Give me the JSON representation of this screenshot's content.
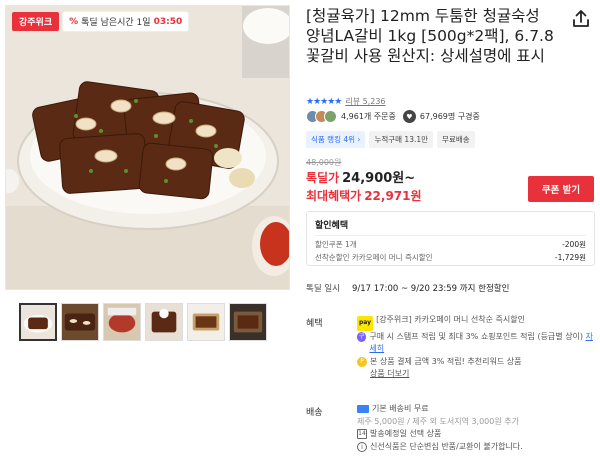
{
  "promo": {
    "store_badge": "강주위크",
    "timer_pct": "%",
    "timer_label": "톡딜 남은시간 1일",
    "timer_time": "03:50"
  },
  "product": {
    "title": "[청귤육가] 12mm 두툼한 청귤숙성 양념LA갈비 1kg [500g*2팩], 6.7.8 꽃갈비 사용 원산지: 상세설명에 표시"
  },
  "rating": {
    "stars": "★★★★★",
    "review_text": "리뷰 5,236"
  },
  "social": {
    "orders": "4,961개 주문중",
    "subscribers": "67,969명 구경중"
  },
  "chips": [
    {
      "label": "식품 랭킹 4위 ›"
    },
    {
      "label": "누적구매 13.1만"
    },
    {
      "label": "무료배송"
    }
  ],
  "price": {
    "original": "48,000원",
    "deal_label": "톡딜가",
    "deal_value": "24,900원~",
    "max_label": "최대혜택가",
    "max_value": "22,971원",
    "coupon_button": "쿠폰 받기"
  },
  "discount": {
    "header": "할인혜택",
    "rows": [
      {
        "label": "할인쿠폰 1개",
        "amount": "-200원"
      },
      {
        "label": "선착순할인 카카오페이 머니 즉시할인",
        "amount": "-1,729원"
      }
    ]
  },
  "special": {
    "label": "톡딜 일시",
    "period": "9/17 17:00 ~ 9/20 23:59",
    "suffix": "까지 한정할인"
  },
  "benefits": {
    "label": "혜택",
    "kakao_icon": "pay",
    "kakao_text": "[강주위크] 카카오페이 머니 선착순 즉시할인",
    "stamp_icon": "구",
    "stamp_text": "구매 시 스탬프 적립 및 최대 3% 쇼핑포인트 적립 (등급별 상이)",
    "stamp_link": "자세히",
    "coin_icon": "P",
    "coin_text": "본 상품 결제 금액 3% 적립! 추천리워드 상품",
    "coin_link": "상품 더보기"
  },
  "delivery": {
    "label": "배송",
    "fee": "기본 배송비 무료",
    "fee_sub": "제주 5,000원 / 제주 외 도서지역 3,000원 추가",
    "schedule_icon": "14",
    "schedule": "발송예정일 선택 상품",
    "info_icon": "i",
    "notice": "신선식품은 단순변심 반품/교환이 불가합니다."
  },
  "colors": {
    "accent_red": "#e8313b",
    "link_blue": "#2b6cf6",
    "kakao_yellow": "#fee500"
  }
}
